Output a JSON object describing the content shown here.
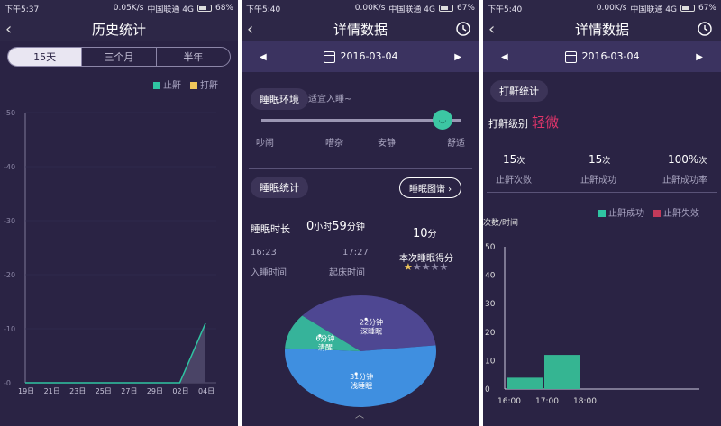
{
  "colors": {
    "teal": "#2fc4a2",
    "yellow": "#f0c65a",
    "red": "#c23a5a",
    "purple_pie": "#4e4792",
    "blue_pie": "#3f8fe0",
    "green_pie": "#36b39a"
  },
  "panel1": {
    "status": {
      "time": "下午5:37",
      "net": "0.05K/s",
      "carrier": "中国联通 4G",
      "battery": "68%",
      "battery_level": 0.68
    },
    "title": "历史统计",
    "tabs": [
      "15天",
      "三个月",
      "半年"
    ],
    "legend": [
      "止鼾",
      "打鼾"
    ],
    "chart_data": {
      "type": "line",
      "x": [
        "19日",
        "21日",
        "23日",
        "25日",
        "27日",
        "29日",
        "02日",
        "04日"
      ],
      "series": [
        {
          "name": "止鼾",
          "values": [
            0,
            0,
            0,
            0,
            0,
            0,
            0,
            11
          ]
        }
      ],
      "yticks": [
        "-50",
        "-40",
        "-30",
        "-20",
        "-10",
        "-0"
      ],
      "ylim": [
        0,
        50
      ]
    }
  },
  "panel2": {
    "status": {
      "time": "下午5:40",
      "net": "0.00K/s",
      "carrier": "中国联通 4G",
      "battery": "67%",
      "battery_level": 0.67
    },
    "title": "详情数据",
    "date": "2016-03-04",
    "env_label": "睡眠环境",
    "env_hint": "适宜入睡~",
    "env_scale": [
      "吵闹",
      "嘈杂",
      "安静",
      "舒适"
    ],
    "env_level": 1.0,
    "stats_label": "睡眠统计",
    "chart_link": "睡眠图谱",
    "duration_label": "睡眠时长",
    "duration_h": "0",
    "duration_h_unit": "小时",
    "duration_m": "59",
    "duration_m_unit": "分钟",
    "start_time": "16:23",
    "end_time": "17:27",
    "start_label": "入睡时间",
    "end_label": "起床时间",
    "score": "10",
    "score_unit": "分",
    "score_label": "本次睡眠得分",
    "stars": 0.5,
    "pie": [
      {
        "value": "22分钟",
        "label": "深睡眠",
        "minutes": 22
      },
      {
        "value": "31分钟",
        "label": "浅睡眠",
        "minutes": 31
      },
      {
        "value": "6分钟",
        "label": "清醒",
        "minutes": 6
      }
    ]
  },
  "panel3": {
    "status": {
      "time": "下午5:40",
      "net": "0.00K/s",
      "carrier": "中国联通 4G",
      "battery": "67%",
      "battery_level": 0.67
    },
    "title": "详情数据",
    "date": "2016-03-04",
    "snore_label": "打鼾统计",
    "level_label": "打鼾级别",
    "level_value": "轻微",
    "stats": [
      {
        "num": "15",
        "unit": "次",
        "label": "止鼾次数"
      },
      {
        "num": "15",
        "unit": "次",
        "label": "止鼾成功"
      },
      {
        "num": "100%",
        "unit": "次",
        "label": "止鼾成功率"
      }
    ],
    "legend": [
      "止鼾成功",
      "止鼾失效"
    ],
    "ylabel": "次数/时间",
    "chart_data": {
      "type": "bar",
      "categories": [
        "16:00",
        "17:00",
        "18:00"
      ],
      "series": [
        {
          "name": "止鼾成功",
          "values": [
            4,
            12,
            0
          ]
        }
      ],
      "yticks": [
        "50",
        "40",
        "30",
        "20",
        "10",
        "0"
      ],
      "ylim": [
        0,
        50
      ]
    }
  }
}
